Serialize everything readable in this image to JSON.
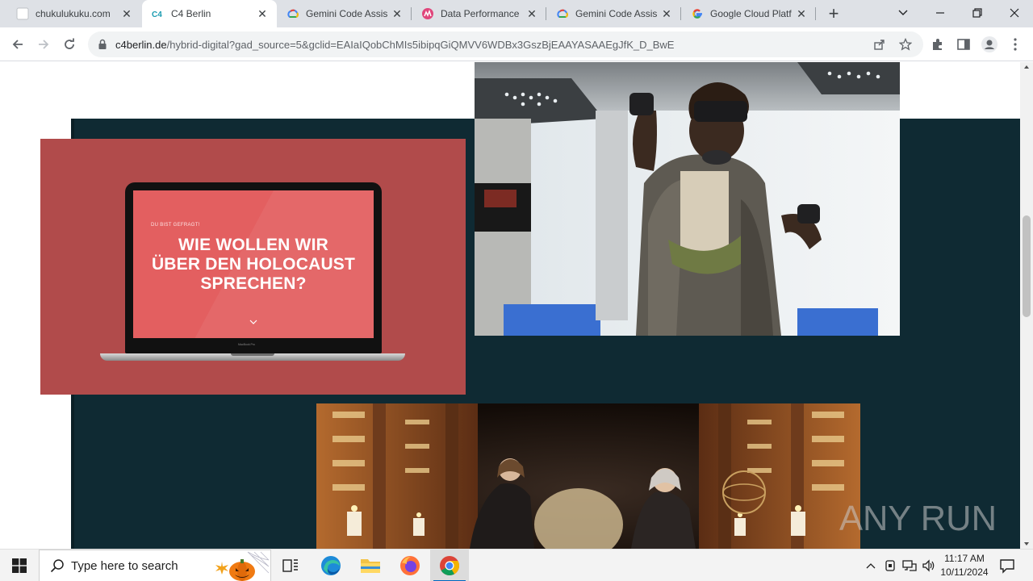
{
  "browser": {
    "tabs": [
      {
        "title": "chukulukuku.com",
        "icon": "blank-page-icon",
        "active": false
      },
      {
        "title": "C4 Berlin",
        "icon": "c4-logo-icon",
        "active": true
      },
      {
        "title": "Gemini Code Assis",
        "icon": "google-cloud-icon",
        "active": false
      },
      {
        "title": "Data Performance",
        "icon": "data-performance-icon",
        "active": false
      },
      {
        "title": "Gemini Code Assis",
        "icon": "google-cloud-icon",
        "active": false
      },
      {
        "title": "Google Cloud Platf",
        "icon": "google-g-icon",
        "active": false
      }
    ],
    "new_tab_symbol": "+",
    "address": {
      "host": "c4berlin.de",
      "path": "/hybrid-digital?gad_source=5&gclid=EAIaIQobChMIs5ibipqGiQMVV6WDBx3GszBjEAAYASAAEgJfK_D_BwE"
    }
  },
  "page": {
    "laptop_screen": {
      "kicker": "DU BIST GEFRAGT!",
      "headline_lines": [
        "WIE WOLLEN WIR",
        "ÜBER DEN HOLOCAUST",
        "SPRECHEN?"
      ],
      "brand": "MacBook Pro"
    },
    "watermark": "ANY RUN",
    "colors": {
      "dark_panel": "#0f2a33",
      "red_card": "#b14b4b",
      "laptop_screen": "#e35f60"
    }
  },
  "taskbar": {
    "search_placeholder": "Type here to search",
    "clock_time": "11:17 AM",
    "clock_date": "10/11/2024"
  }
}
